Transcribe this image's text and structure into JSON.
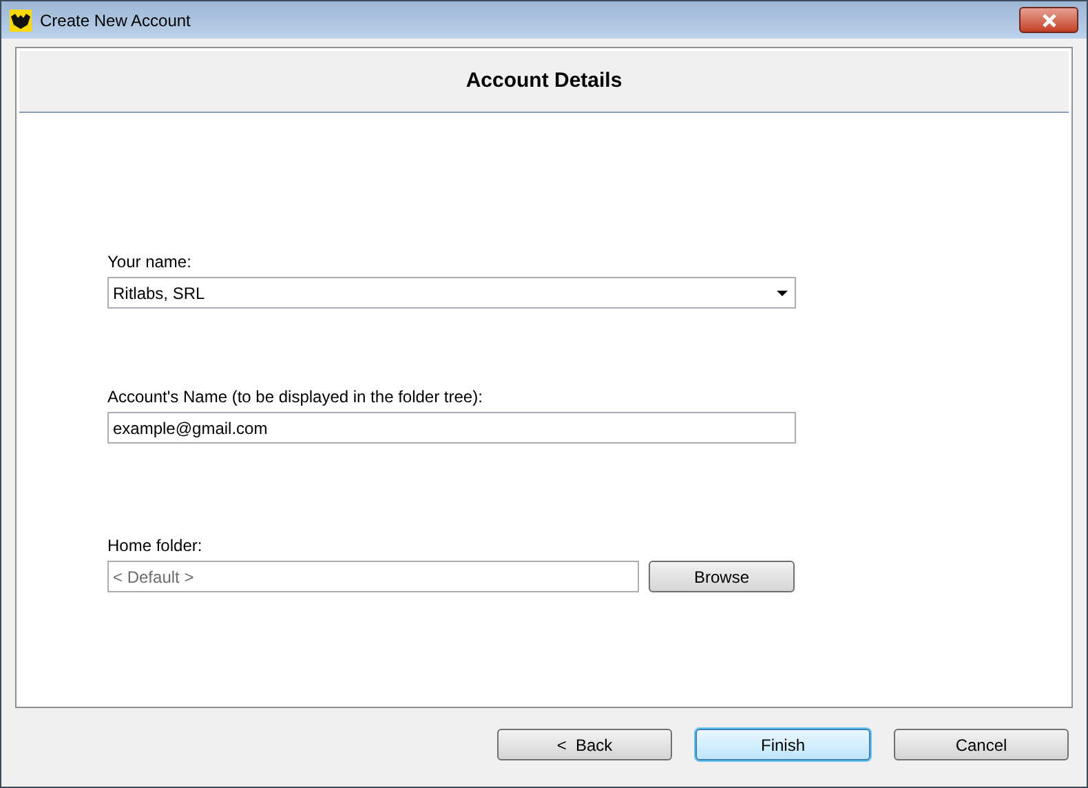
{
  "window": {
    "title": "Create New Account"
  },
  "header": {
    "title": "Account Details"
  },
  "fields": [
    {
      "kind": "combo",
      "label": "Your name:",
      "value": "Ritlabs, SRL"
    },
    {
      "kind": "text",
      "label": "Account's Name (to be displayed in the folder tree):",
      "value": "example@gmail.com"
    },
    {
      "kind": "browse",
      "label": "Home folder:",
      "placeholder": "< Default >",
      "button": "Browse"
    }
  ],
  "buttons": [
    {
      "label": "<  Back",
      "default": false
    },
    {
      "label": "Finish",
      "default": true
    },
    {
      "label": "Cancel",
      "default": false
    }
  ]
}
